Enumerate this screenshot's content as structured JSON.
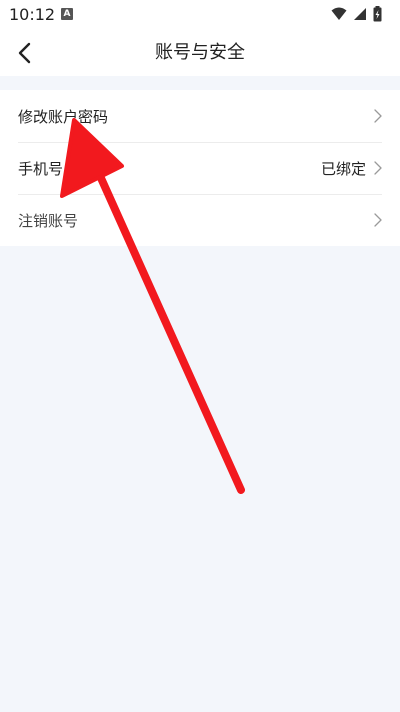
{
  "status_bar": {
    "time": "10:12",
    "notification_icon": "a-icon",
    "right_icons": [
      "wifi-icon",
      "signal-icon",
      "battery-icon"
    ]
  },
  "header": {
    "title": "账号与安全",
    "back_icon": "chevron-left-icon"
  },
  "settings": {
    "items": [
      {
        "label": "修改账户密码",
        "value": ""
      },
      {
        "label": "手机号",
        "value": "已绑定"
      },
      {
        "label": "注销账号",
        "value": ""
      }
    ]
  },
  "colors": {
    "background": "#f3f6fb",
    "surface": "#ffffff",
    "annotation_arrow": "#f2191e",
    "chevron": "#9a9a9a"
  }
}
